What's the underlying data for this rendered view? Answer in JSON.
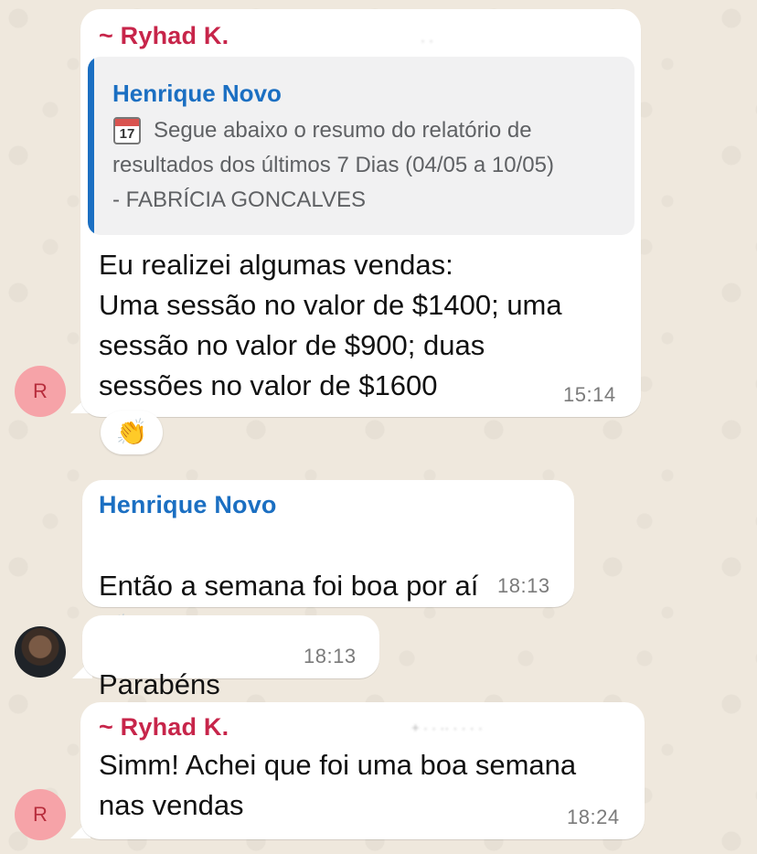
{
  "messages": [
    {
      "sender": "~ Ryhad K.",
      "quoted": {
        "sender": "Henrique Novo",
        "calendar_day": "17",
        "text": "Segue abaixo o resumo do relatório de\nresultados dos últimos 7 Dias (04/05 a 10/05)\n- FABRÍCIA GONCALVES"
      },
      "text": "Eu realizei algumas vendas:\nUma sessão no valor de $1400; uma\nsessão no valor de $900; duas\nsessões no valor de $1600",
      "time": "15:14",
      "reaction": "👏",
      "avatar_letter": "R"
    },
    {
      "sender": "Henrique Novo",
      "text": "Então a semana foi boa por aí",
      "emoji": "👏🏽",
      "time": "18:13"
    },
    {
      "text": "Parabéns",
      "emoji": "🍾",
      "time": "18:13"
    },
    {
      "sender": "~ Ryhad K.",
      "text": "Simm! Achei que foi uma boa semana\nnas vendas",
      "time": "18:24",
      "avatar_letter": "R"
    }
  ],
  "colors": {
    "ryhad": "#c7254a",
    "henrique": "#1b6fc2",
    "bubble": "#ffffff",
    "wallpaper": "#efe8dd"
  },
  "icons": [
    "calendar-icon",
    "clapping-hands-emoji",
    "champagne-emoji"
  ]
}
